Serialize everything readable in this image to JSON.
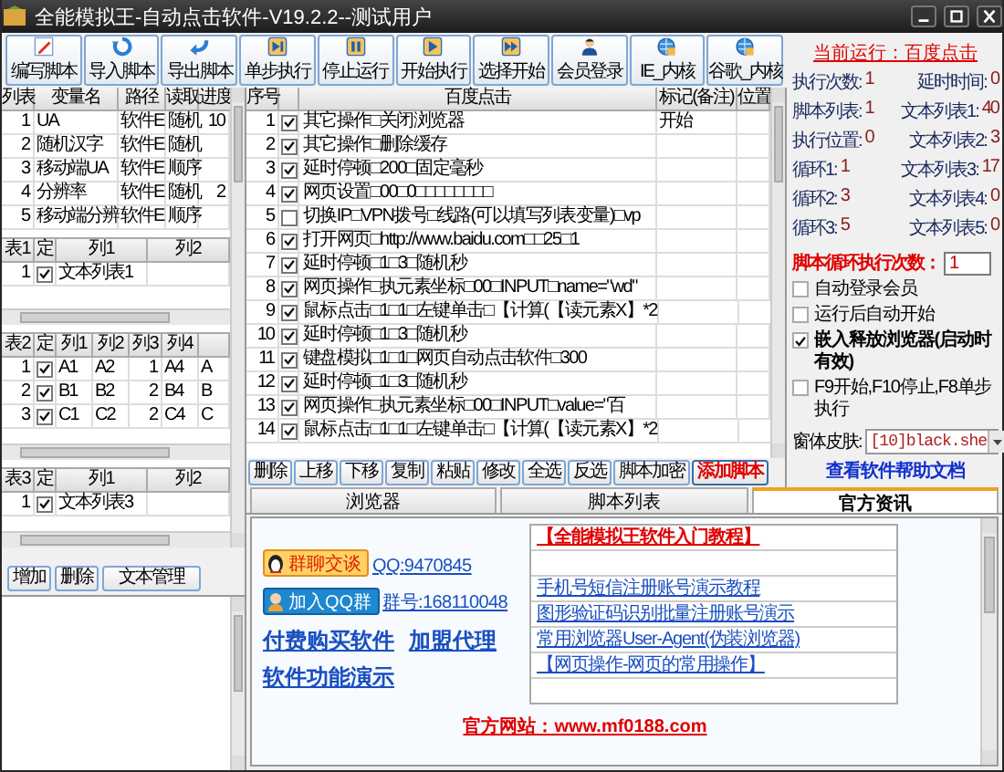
{
  "window": {
    "title": "全能模拟王-自动点击软件-V19.2.2--测试用户"
  },
  "toolbar": [
    {
      "label": "编写脚本"
    },
    {
      "label": "导入脚本"
    },
    {
      "label": "导出脚本"
    },
    {
      "label": "单步执行"
    },
    {
      "label": "停止运行"
    },
    {
      "label": "开始执行"
    },
    {
      "label": "选择开始"
    },
    {
      "label": "会员登录"
    },
    {
      "label": "IE_内核"
    },
    {
      "label": "谷歌_内核"
    }
  ],
  "variables": {
    "columns": [
      "列表",
      "变量名",
      "路径",
      "读取",
      "进度"
    ],
    "rows": [
      {
        "cells": [
          "1",
          "UA",
          "软件E",
          "随机",
          "10"
        ]
      },
      {
        "cells": [
          "2",
          "随机汉字",
          "软件E",
          "随机"
        ]
      },
      {
        "cells": [
          "3",
          "移动端UA",
          "软件E",
          "顺序"
        ]
      },
      {
        "cells": [
          "4",
          "分辨率",
          "软件E",
          "随机",
          "2"
        ]
      },
      {
        "cells": [
          "5",
          "移动端分辨",
          "软件E",
          "顺序"
        ]
      }
    ]
  },
  "text_tables": [
    {
      "corner": "表1",
      "check_header": "定",
      "columns": [
        "列1",
        "列2"
      ],
      "rows": [
        {
          "index": "1",
          "checked": true,
          "cells": [
            "文本列表1"
          ]
        }
      ]
    },
    {
      "corner": "表2",
      "check_header": "定",
      "columns": [
        "列1",
        "列2",
        "列3",
        "列4"
      ],
      "rows": [
        {
          "index": "1",
          "checked": true,
          "cells": [
            "A1",
            "A2",
            "1",
            "A4",
            "A"
          ]
        },
        {
          "index": "2",
          "checked": true,
          "cells": [
            "B1",
            "B2",
            "2",
            "B4",
            "B"
          ]
        },
        {
          "index": "3",
          "checked": true,
          "cells": [
            "C1",
            "C2",
            "2",
            "C4",
            "C"
          ]
        }
      ]
    },
    {
      "corner": "表3",
      "check_header": "定",
      "columns": [
        "列1",
        "列2"
      ],
      "rows": [
        {
          "index": "1",
          "checked": true,
          "cells": [
            "文本列表3"
          ]
        }
      ]
    }
  ],
  "list_buttons": [
    "增加",
    "删除",
    "文本管理"
  ],
  "script": {
    "index_header": "序号",
    "columns": [
      "百度点击",
      "标记(备注)",
      "位置"
    ],
    "rows": [
      {
        "index": "1",
        "checked": true,
        "cells": [
          "其它操作□关闭浏览器",
          "开始"
        ]
      },
      {
        "index": "2",
        "checked": true,
        "cells": [
          "其它操作□删除缓存"
        ]
      },
      {
        "index": "3",
        "checked": true,
        "cells": [
          "延时停顿□200□固定毫秒"
        ]
      },
      {
        "index": "4",
        "checked": true,
        "cells": [
          "网页设置□00□0□□□□□□□□"
        ]
      },
      {
        "index": "5",
        "checked": false,
        "cells": [
          "切换IP□VPN拨号□线路(可以填写列表变量)□vp"
        ]
      },
      {
        "index": "6",
        "checked": true,
        "cells": [
          "打开网页□http://www.baidu.com□□25□1"
        ]
      },
      {
        "index": "7",
        "checked": true,
        "cells": [
          "延时停顿□1□3□随机秒"
        ]
      },
      {
        "index": "8",
        "checked": true,
        "cells": [
          "网页操作□执元素坐标□00□INPUT□name=\"wd\""
        ]
      },
      {
        "index": "9",
        "checked": true,
        "cells": [
          "鼠标点击□1□1□左键单击□【计算(【读元素X】*2"
        ]
      },
      {
        "index": "10",
        "checked": true,
        "cells": [
          "延时停顿□1□3□随机秒"
        ]
      },
      {
        "index": "11",
        "checked": true,
        "cells": [
          "键盘模拟□1□1□网页自动点击软件□300"
        ]
      },
      {
        "index": "12",
        "checked": true,
        "cells": [
          "延时停顿□1□3□随机秒"
        ]
      },
      {
        "index": "13",
        "checked": true,
        "cells": [
          "网页操作□执元素坐标□00□INPUT□value=\"百"
        ]
      },
      {
        "index": "14",
        "checked": true,
        "cells": [
          "鼠标点击□1□1□左键单击□【计算(【读元素X】*2"
        ]
      }
    ]
  },
  "script_buttons": [
    {
      "label": "删除",
      "kind": "normal"
    },
    {
      "label": "上移",
      "kind": "normal"
    },
    {
      "label": "下移",
      "kind": "normal"
    },
    {
      "label": "复制",
      "kind": "normal"
    },
    {
      "label": "粘贴",
      "kind": "normal"
    },
    {
      "label": "修改",
      "kind": "normal"
    },
    {
      "label": "全选",
      "kind": "normal"
    },
    {
      "label": "反选",
      "kind": "normal"
    },
    {
      "label": "脚本加密",
      "kind": "normal"
    },
    {
      "label": "添加脚本",
      "kind": "accent"
    }
  ],
  "status": {
    "current": "当前运行：百度点击",
    "stats": [
      {
        "label": "执行次数:",
        "value": "1"
      },
      {
        "label": "延时时间:",
        "value": "0"
      },
      {
        "label": "脚本列表:",
        "value": "1"
      },
      {
        "label": "文本列表1:",
        "value": "40"
      },
      {
        "label": "执行位置:",
        "value": "0"
      },
      {
        "label": "文本列表2:",
        "value": "3"
      },
      {
        "label": "循环1:",
        "value": "1"
      },
      {
        "label": "文本列表3:",
        "value": "17"
      },
      {
        "label": "循环2:",
        "value": "3"
      },
      {
        "label": "文本列表4:",
        "value": "0"
      },
      {
        "label": "循环3:",
        "value": "5"
      },
      {
        "label": "文本列表5:",
        "value": "0"
      }
    ]
  },
  "loop_count": {
    "label": "脚本循环执行次数：",
    "value": "1"
  },
  "options": [
    {
      "label": "自动登录会员",
      "checked": false
    },
    {
      "label": "运行后自动开始",
      "checked": false
    },
    {
      "label": "嵌入释放浏览器(启动时有效)",
      "checked": true
    },
    {
      "label": "F9开始,F10停止,F8单步执行",
      "checked": false
    }
  ],
  "skin": {
    "label": "窗体皮肤:",
    "value": "[10]black.she"
  },
  "help_link": "查看软件帮助文档",
  "tabs": [
    {
      "label": "浏览器",
      "selected": false
    },
    {
      "label": "脚本列表",
      "selected": false
    },
    {
      "label": "官方资讯",
      "selected": true
    }
  ],
  "news": {
    "contacts": [
      {
        "kind": "chat",
        "badge": "群聊交谈",
        "link": "QQ:9470845"
      },
      {
        "kind": "group",
        "badge": "加入QQ群",
        "link": "群号:168110048"
      }
    ],
    "links": [
      "付费购买软件",
      "加盟代理",
      "软件功能演示"
    ],
    "articles": [
      {
        "title": "【全能模拟王软件入门教程】",
        "highlight": true
      },
      {
        "title": "手机号短信注册账号演示教程",
        "highlight": false
      },
      {
        "title": "图形验证码识别批量注册账号演示",
        "highlight": false
      },
      {
        "title": "常用浏览器User-Agent(伪装浏览器)",
        "highlight": false
      },
      {
        "title": "【网页操作-网页的常用操作】",
        "highlight": false
      }
    ],
    "website": "官方网站：www.mf0188.com"
  }
}
